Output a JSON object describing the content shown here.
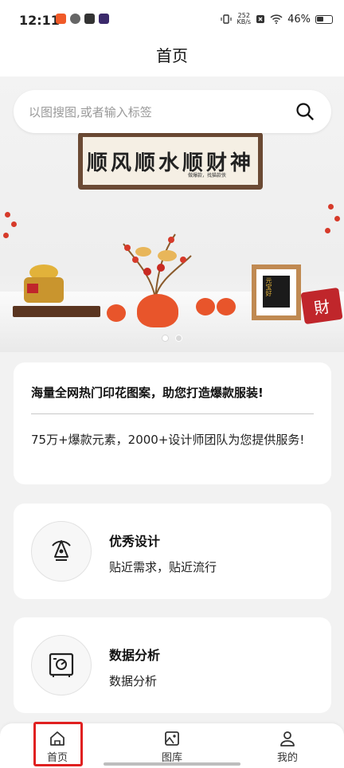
{
  "status_bar": {
    "time": "12:11",
    "network_speed_value": "252",
    "network_speed_unit": "KB/s",
    "battery": "46%",
    "app_icons": [
      "app-red-icon",
      "app-gray-icon",
      "app-dark-icon",
      "app-purple-icon"
    ]
  },
  "header": {
    "title": "首页"
  },
  "search": {
    "placeholder": "以图搜图,或者输入标签"
  },
  "banner": {
    "scroll_text": "顺风顺水顺财神",
    "scroll_sub": "做爆款，找猫款侠",
    "frame_text": "元宝好",
    "sign_text": "財",
    "pagination": {
      "total": 2,
      "current": 1
    }
  },
  "intro": {
    "headline": "海量全网热门印花图案，助您打造爆款服装!",
    "description": "75万+爆款元素，2000+设计师团队为您提供服务!"
  },
  "features": [
    {
      "title": "优秀设计",
      "description": "贴近需求，贴近流行",
      "icon": "pen-nib-icon"
    },
    {
      "title": "数据分析",
      "description": "数据分析",
      "icon": "safe-icon"
    }
  ],
  "nav": {
    "home": "首页",
    "gallery": "图库",
    "mine": "我的"
  },
  "colors": {
    "accent_red": "#e02020",
    "banner_orange": "#e8552b",
    "background": "#f2f2f2"
  }
}
